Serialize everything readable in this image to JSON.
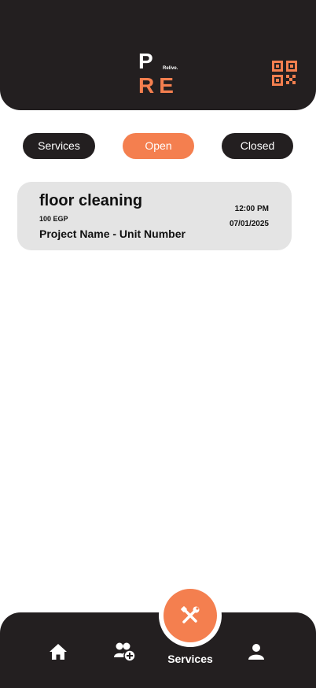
{
  "header": {
    "logo_top": "P",
    "logo_tagline": "Relive.",
    "logo_bottom": "RE",
    "qr_icon": "qr-code-icon"
  },
  "filters": [
    {
      "label": "Services",
      "active": false
    },
    {
      "label": "Open",
      "active": true
    },
    {
      "label": "Closed",
      "active": false
    }
  ],
  "requests": [
    {
      "title": "floor cleaning",
      "price": "100 EGP",
      "project": "Project Name - Unit Number",
      "time": "12:00 PM",
      "date": "07/01/2025"
    }
  ],
  "bottom_nav": {
    "items": [
      {
        "icon": "home-icon"
      },
      {
        "icon": "add-user-icon"
      },
      {
        "icon": "tools-icon",
        "label": "Services",
        "active": true
      },
      {
        "icon": "profile-icon"
      }
    ]
  },
  "colors": {
    "primary_dark": "#231f20",
    "accent": "#f47f4f",
    "card_bg": "#e4e4e4",
    "background": "#ffffff"
  }
}
